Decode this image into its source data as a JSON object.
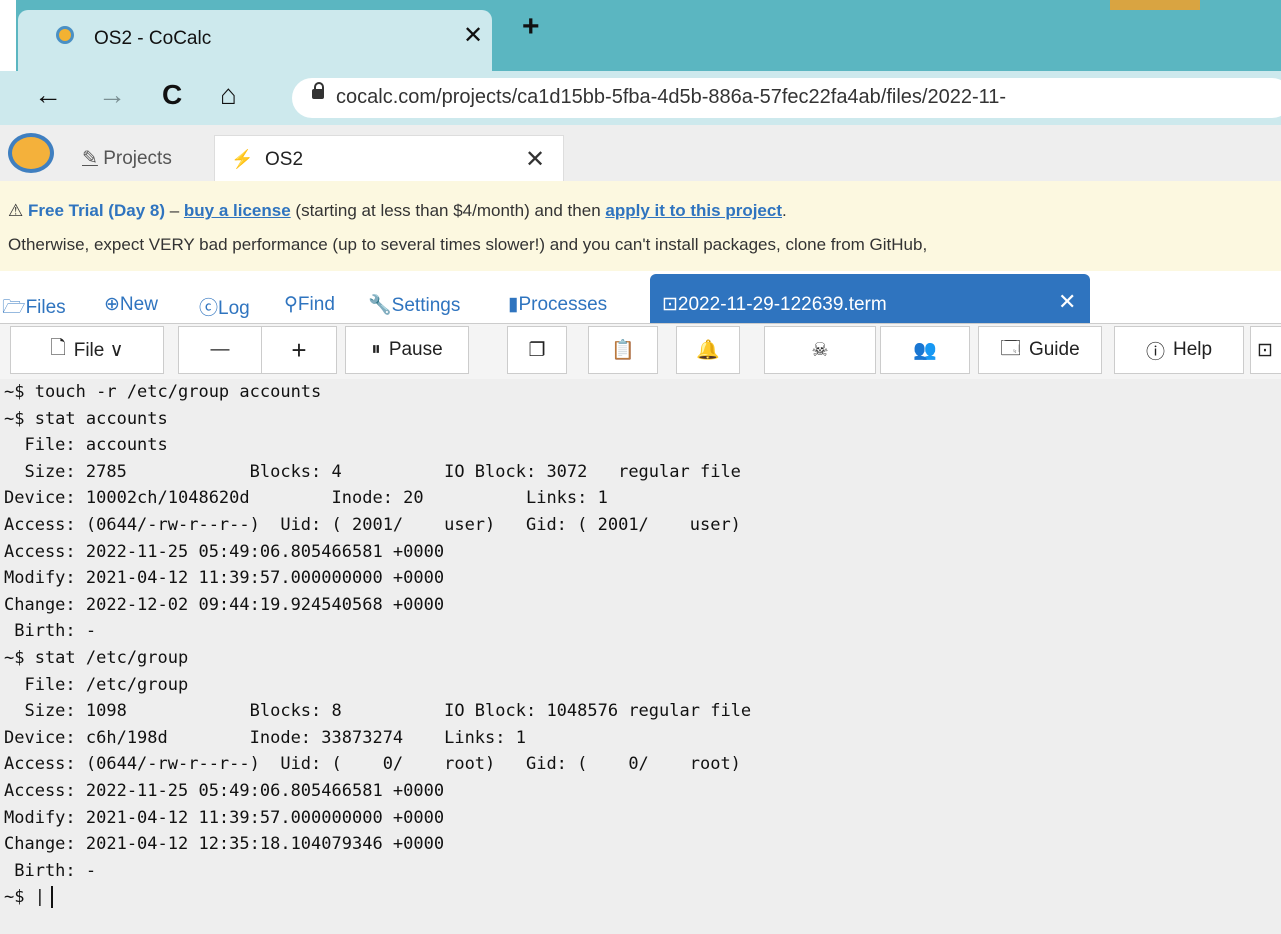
{
  "browser": {
    "tab_title": "OS2 - CoCalc",
    "tab_close": "✕",
    "new_tab": "+",
    "url": "cocalc.com/projects/ca1d15bb-5fba-4d5b-886a-57fec22fa4ab/files/2022-11-",
    "back": "←",
    "forward": "→",
    "reload": "C",
    "home": "⌂"
  },
  "cocalc": {
    "projects_label": "Projects",
    "project_tab_label": "OS2",
    "project_tab_close": "✕"
  },
  "banner": {
    "warning_icon": "⚠",
    "free_trial": "Free Trial (Day 8)",
    "dash": " – ",
    "buy_link": "buy a license",
    "mid_text": " (starting at less than $4/month) and then ",
    "apply_link": "apply it to this project",
    "period": ".",
    "line2": "Otherwise, expect VERY bad performance (up to several times slower!) and you can't install packages, clone from GitHub,"
  },
  "file_tabs": {
    "files": "Files",
    "new": "New",
    "log": "Log",
    "find": "Find",
    "settings": "Settings",
    "processes": "Processes",
    "term_tab": "2022-11-29-122639.term",
    "term_close": "✕"
  },
  "toolbar": {
    "file": "File ∨",
    "minus": "—",
    "plus": "+",
    "pause": "Pause",
    "guide": "Guide",
    "help": "Help"
  },
  "terminal": {
    "lines": [
      "~$ touch -r /etc/group accounts",
      "~$ stat accounts",
      "  File: accounts",
      "  Size: 2785            Blocks: 4          IO Block: 3072   regular file",
      "Device: 10002ch/1048620d        Inode: 20          Links: 1",
      "Access: (0644/-rw-r--r--)  Uid: ( 2001/    user)   Gid: ( 2001/    user)",
      "Access: 2022-11-25 05:49:06.805466581 +0000",
      "Modify: 2021-04-12 11:39:57.000000000 +0000",
      "Change: 2022-12-02 09:44:19.924540568 +0000",
      " Birth: -",
      "~$ stat /etc/group",
      "  File: /etc/group",
      "  Size: 1098            Blocks: 8          IO Block: 1048576 regular file",
      "Device: c6h/198d        Inode: 33873274    Links: 1",
      "Access: (0644/-rw-r--r--)  Uid: (    0/    root)   Gid: (    0/    root)",
      "Access: 2022-11-25 05:49:06.805466581 +0000",
      "Modify: 2021-04-12 11:39:57.000000000 +0000",
      "Change: 2021-04-12 12:35:18.104079346 +0000",
      " Birth: -"
    ],
    "prompt": "~$ |"
  }
}
